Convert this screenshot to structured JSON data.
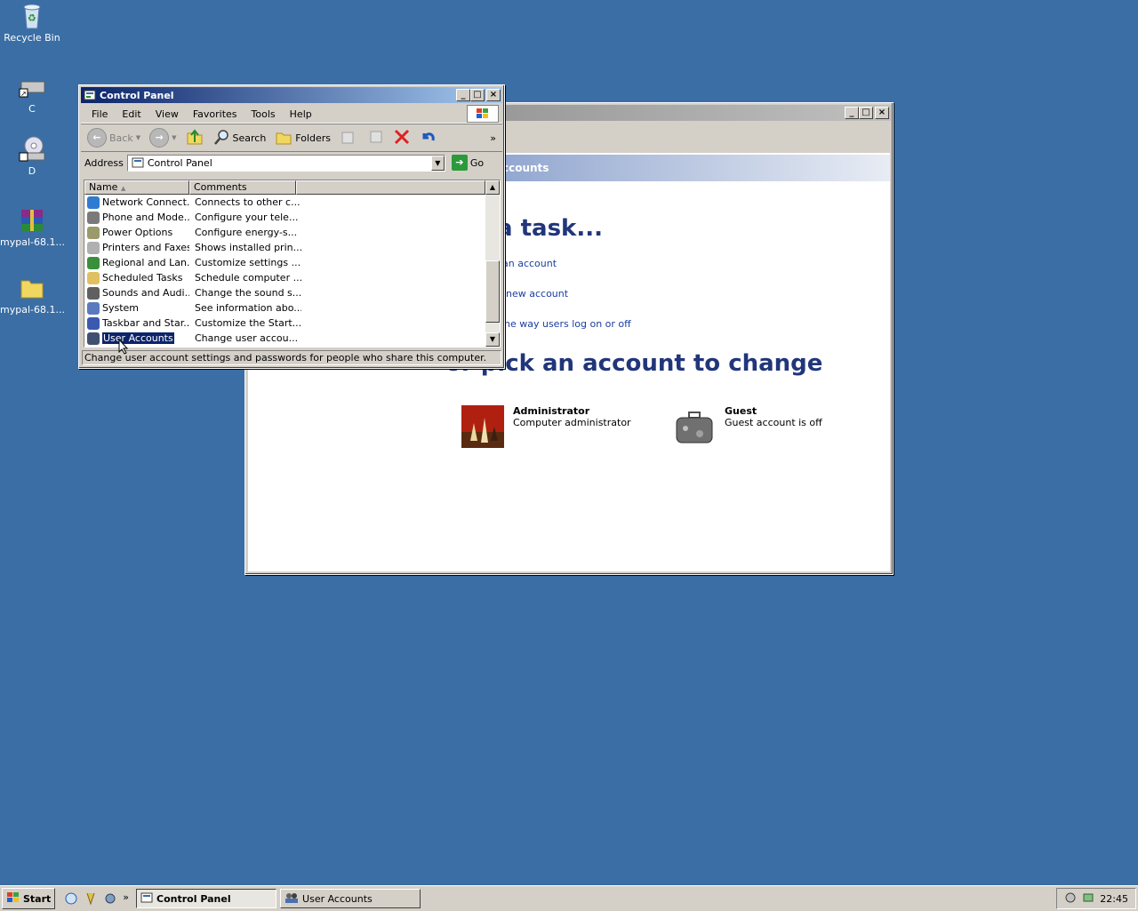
{
  "desktop": {
    "icons": [
      {
        "label": "Recycle Bin"
      },
      {
        "label": "C"
      },
      {
        "label": "D"
      },
      {
        "label": "mypal-68.1..."
      },
      {
        "label": "mypal-68.1..."
      }
    ]
  },
  "ua_window": {
    "banner": "ccounts",
    "heading_task": "a task...",
    "links": [
      "an account",
      "new account",
      "he way users log on or off"
    ],
    "heading_pick": "or pick an account to change",
    "accounts": [
      {
        "name": "Administrator",
        "desc": "Computer administrator"
      },
      {
        "name": "Guest",
        "desc": "Guest account is off"
      }
    ]
  },
  "cp_window": {
    "title": "Control Panel",
    "menu": [
      "File",
      "Edit",
      "View",
      "Favorites",
      "Tools",
      "Help"
    ],
    "toolbar": {
      "back": "Back",
      "search": "Search",
      "folders": "Folders",
      "more": "»"
    },
    "address": {
      "label": "Address",
      "value": "Control Panel",
      "go": "Go"
    },
    "columns": [
      "Name",
      "Comments"
    ],
    "rows": [
      {
        "name": "Network Connect...",
        "comment": "Connects to other c...",
        "color": "#2e7bd1"
      },
      {
        "name": "Phone and Mode...",
        "comment": "Configure your tele...",
        "color": "#7a7a7a"
      },
      {
        "name": "Power Options",
        "comment": "Configure energy-s...",
        "color": "#9a9a6a"
      },
      {
        "name": "Printers and Faxes",
        "comment": "Shows installed prin...",
        "color": "#b0b0b0"
      },
      {
        "name": "Regional and Lan...",
        "comment": "Customize settings ...",
        "color": "#3a8f3a"
      },
      {
        "name": "Scheduled Tasks",
        "comment": "Schedule computer ...",
        "color": "#e0c060"
      },
      {
        "name": "Sounds and Audi...",
        "comment": "Change the sound s...",
        "color": "#606060"
      },
      {
        "name": "System",
        "comment": "See information abo...",
        "color": "#5a7ac0"
      },
      {
        "name": "Taskbar and Star...",
        "comment": "Customize the Start...",
        "color": "#3a5ab0"
      },
      {
        "name": "User Accounts",
        "comment": "Change user accou...",
        "color": "#405070",
        "selected": true
      }
    ],
    "status": "Change user account settings and passwords for people who share this computer."
  },
  "taskbar": {
    "start": "Start",
    "more": "»",
    "tasks": [
      {
        "label": "Control Panel",
        "active": true
      },
      {
        "label": "User Accounts",
        "active": false
      }
    ],
    "clock": "22:45"
  }
}
